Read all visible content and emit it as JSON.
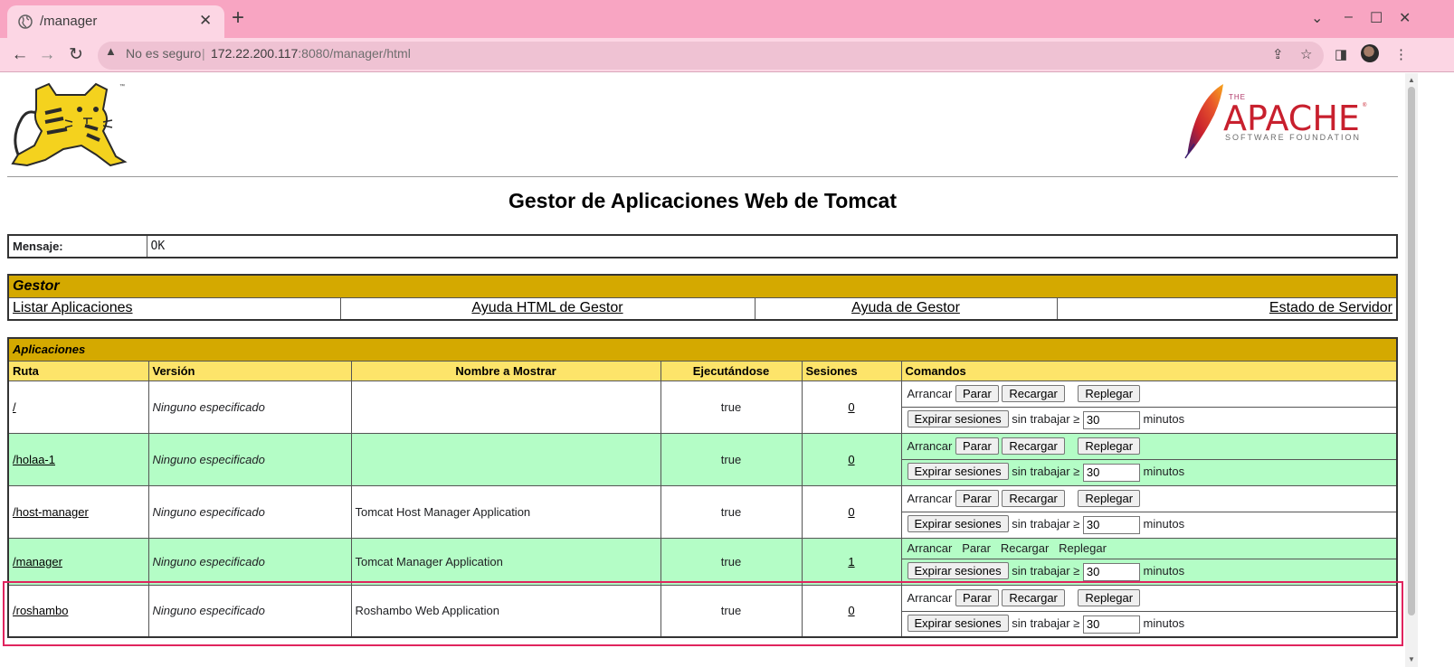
{
  "browser": {
    "tab_title": "/manager",
    "tab_close": "✕",
    "new_tab": "+",
    "back": "←",
    "forward": "→",
    "reload": "↻",
    "insecure_label": "No es seguro",
    "separator": "|",
    "url_host": "172.22.200.117",
    "url_rest": ":8080/manager/html",
    "win_chevron": "⌄",
    "win_min": "–",
    "win_max": "☐",
    "win_close": "✕",
    "share_icon": "⇪",
    "star_icon": "☆",
    "sidepanel_icon": "◨",
    "menu_icon": "⋮"
  },
  "page": {
    "title": "Gestor de Aplicaciones Web de Tomcat",
    "apache_the": "THE",
    "apache_word": "APACHE",
    "apache_sub": "SOFTWARE FOUNDATION",
    "apache_tm": "®",
    "cat_tm": "™"
  },
  "message": {
    "label": "Mensaje:",
    "value": "OK"
  },
  "manager": {
    "header": "Gestor",
    "links": [
      "Listar Aplicaciones",
      "Ayuda HTML de Gestor",
      "Ayuda de Gestor",
      "Estado de Servidor"
    ]
  },
  "applications": {
    "header": "Aplicaciones",
    "columns": [
      "Ruta",
      "Versión",
      "Nombre a Mostrar",
      "Ejecutándose",
      "Sesiones",
      "Comandos"
    ],
    "commands": {
      "start": "Arrancar",
      "stop": "Parar",
      "reload": "Recargar",
      "undeploy": "Replegar",
      "expire": "Expirar sesiones",
      "idle_prefix": "sin trabajar ≥",
      "minutes": "minutos"
    },
    "rows": [
      {
        "path": "/",
        "version": "Ninguno especificado",
        "display_name": "",
        "running": "true",
        "sessions": "0",
        "idle": "30"
      },
      {
        "path": "/holaa-1",
        "version": "Ninguno especificado",
        "display_name": "",
        "running": "true",
        "sessions": "0",
        "idle": "30"
      },
      {
        "path": "/host-manager",
        "version": "Ninguno especificado",
        "display_name": "Tomcat Host Manager Application",
        "running": "true",
        "sessions": "0",
        "idle": "30"
      },
      {
        "path": "/manager",
        "version": "Ninguno especificado",
        "display_name": "Tomcat Manager Application",
        "running": "true",
        "sessions": "1",
        "idle": "30"
      },
      {
        "path": "/roshambo",
        "version": "Ninguno especificado",
        "display_name": "Roshambo Web Application",
        "running": "true",
        "sessions": "0",
        "idle": "30"
      }
    ]
  },
  "colors": {
    "tab_strip": "#f8a5c2",
    "section_header": "#d4a900",
    "column_header": "#fde46a",
    "row_green": "#b4fdc6",
    "highlight": "#e0245e"
  }
}
